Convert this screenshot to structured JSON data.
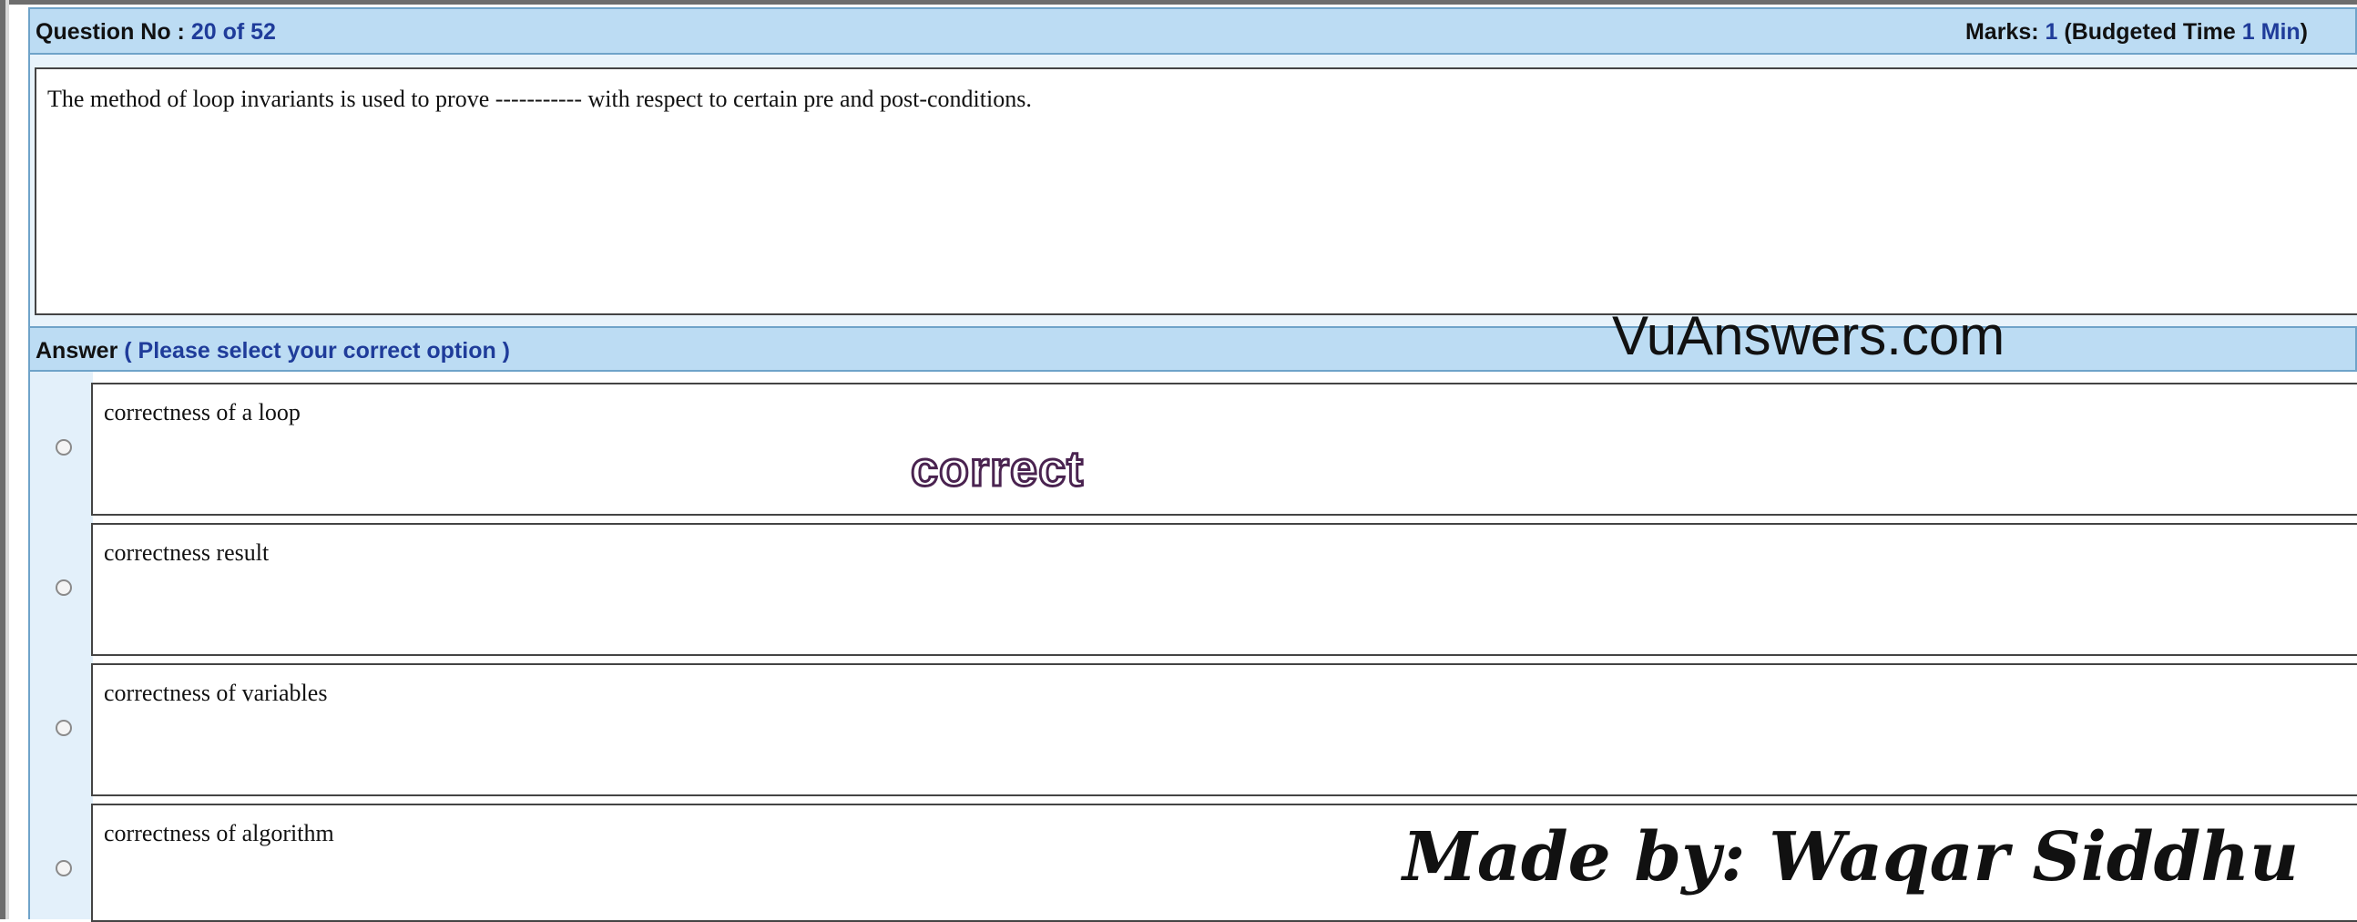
{
  "question_bar": {
    "label": "Question No : ",
    "current": "20",
    "of_text": " of ",
    "total": "52",
    "marks_label": "Marks: ",
    "marks_value": "1",
    "budget_open": " (Budgeted Time ",
    "budget_value": "1 Min",
    "budget_close": ")"
  },
  "question": {
    "text": "The method of loop invariants is used to prove ----------- with respect to certain pre and post-conditions."
  },
  "answer_bar": {
    "label": "Answer ",
    "hint": "( Please select your correct option )"
  },
  "options": [
    {
      "text": "correctness of a loop"
    },
    {
      "text": "correctness result"
    },
    {
      "text": "correctness of variables"
    },
    {
      "text": "correctness of algorithm"
    }
  ],
  "watermarks": {
    "site": "VuAnswers.com",
    "correct_stamp": "correct",
    "made_by": "Made by: Waqar Siddhu"
  },
  "colors": {
    "header_bg": "#bcdcf3",
    "header_border": "#6fa3c9",
    "accent_text": "#1f3c9a"
  }
}
